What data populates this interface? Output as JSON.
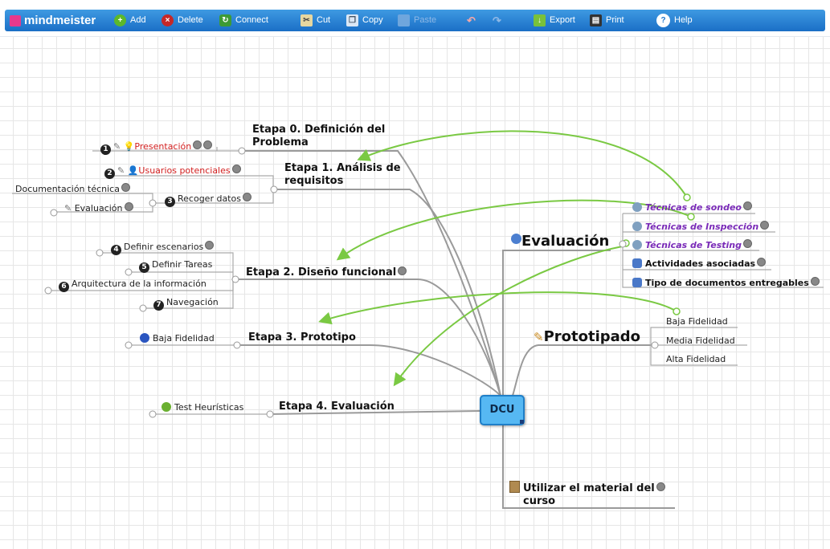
{
  "toolbar": {
    "logo": "mindmeister",
    "add": "Add",
    "delete": "Delete",
    "connect": "Connect",
    "cut": "Cut",
    "copy": "Copy",
    "paste": "Paste",
    "export": "Export",
    "print": "Print",
    "help": "Help"
  },
  "map": {
    "root": "DCU",
    "etapa0": {
      "title_line1": "Etapa 0. Definición del",
      "title_line2": "Problema",
      "presentacion": "Presentación"
    },
    "etapa1": {
      "title_line1": "Etapa 1. Análisis de",
      "title_line2": "requisitos",
      "usuarios": "Usuarios potenciales",
      "recoger": "Recoger datos",
      "documentacion": "Documentación técnica",
      "evaluacion": "Evaluación"
    },
    "etapa2": {
      "title": "Etapa 2. Diseño funcional",
      "escenarios": "Definir escenarios",
      "tareas": "Definir Tareas",
      "arquitectura": "Arquitectura de la información",
      "navegacion": "Navegación"
    },
    "etapa3": {
      "title": "Etapa 3. Prototipo",
      "baja": "Baja Fidelidad"
    },
    "etapa4": {
      "title": "Etapa 4. Evaluación",
      "test": "Test Heurísticas"
    },
    "evaluacion": {
      "title": "Evaluación",
      "sondeo": "Técnicas de sondeo",
      "inspeccion": "Técnicas de Inspección",
      "testing": "Técnicas de Testing",
      "actividades": "Actividades asociadas",
      "tipo": "Tipo de documentos entregables"
    },
    "prototipado": {
      "title": "Prototipado",
      "baja": "Baja Fidelidad",
      "media": "Media Fidelidad",
      "alta": "Alta Fidelidad"
    },
    "material": {
      "title_line1": "Utilizar el material del",
      "title_line2": "curso"
    }
  },
  "colors": {
    "toolbar": "#1f77cc",
    "root_fill": "#56b8f3",
    "connector": "#7ac943",
    "branch": "#9a9a9a",
    "link_red": "#d32020",
    "link_purple": "#7a2bb8"
  }
}
